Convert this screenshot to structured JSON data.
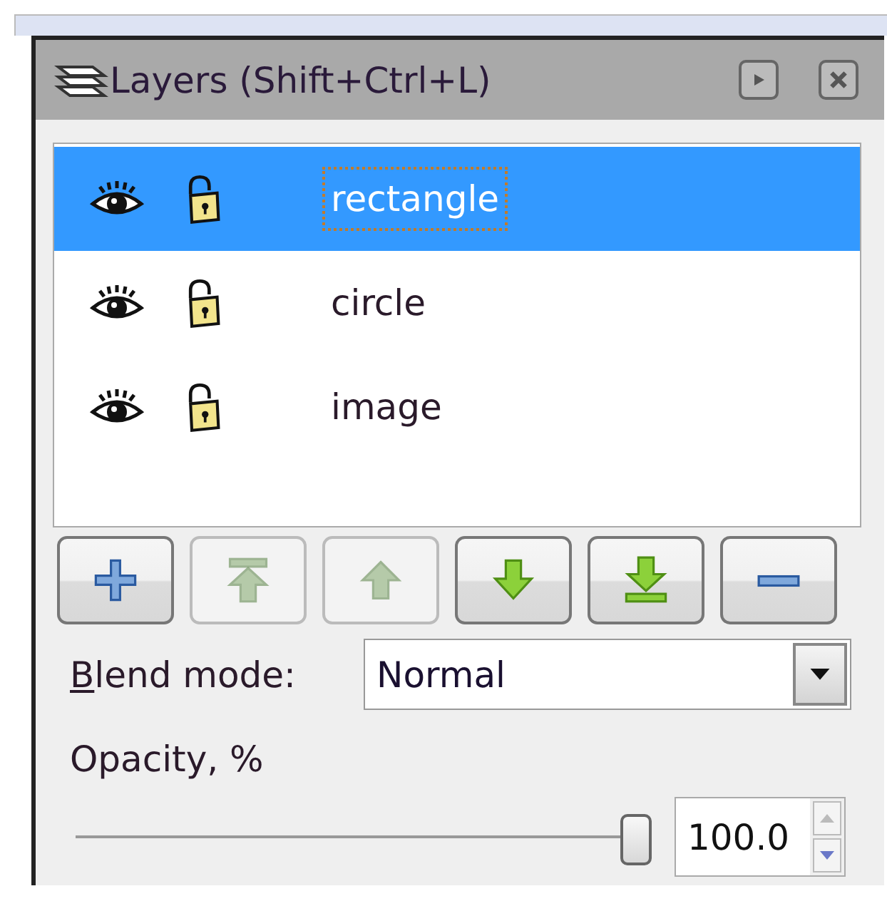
{
  "panel": {
    "title": "Layers (Shift+Ctrl+L)"
  },
  "layers": [
    {
      "name": "rectangle",
      "visible": true,
      "locked": false,
      "selected": true
    },
    {
      "name": "circle",
      "visible": true,
      "locked": false,
      "selected": false
    },
    {
      "name": "image",
      "visible": true,
      "locked": false,
      "selected": false
    }
  ],
  "buttons": [
    {
      "kind": "add",
      "disabled": false
    },
    {
      "kind": "raise-top",
      "disabled": true
    },
    {
      "kind": "raise",
      "disabled": true
    },
    {
      "kind": "lower",
      "disabled": false
    },
    {
      "kind": "lower-bottom",
      "disabled": false
    },
    {
      "kind": "remove",
      "disabled": false
    }
  ],
  "blend_mode": {
    "label": {
      "mnemonic": "B",
      "rest": "lend mode:"
    },
    "value": "Normal"
  },
  "opacity": {
    "label": "Opacity, %",
    "level": 1,
    "value": "100.0"
  }
}
